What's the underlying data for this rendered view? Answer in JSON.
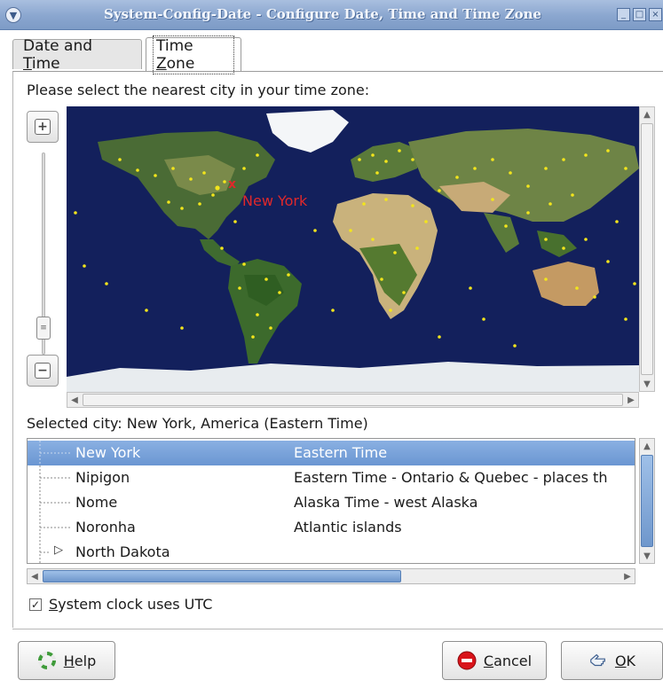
{
  "window": {
    "title": "System-Config-Date - Configure Date, Time and Time Zone",
    "controls": [
      "minimize-icon",
      "maximize-icon",
      "close-icon"
    ]
  },
  "tabs": [
    {
      "label": "Date and Time",
      "mnemonic": "T",
      "active": false
    },
    {
      "label": "Time Zone",
      "mnemonic": "Z",
      "active": true
    }
  ],
  "time_zone": {
    "prompt": "Please select the nearest city in your time zone:",
    "map": {
      "highlight_label": "New York",
      "highlight_marker": "x"
    },
    "zoom": {
      "in_icon": "zoom-in-icon",
      "out_icon": "zoom-out-icon"
    },
    "selected_city": "Selected city: New York, America (Eastern Time)",
    "cities": [
      {
        "name": "New York",
        "zone": "Eastern Time",
        "selected": true,
        "expander": false
      },
      {
        "name": "Nipigon",
        "zone": "Eastern Time - Ontario & Quebec - places th",
        "selected": false,
        "expander": false
      },
      {
        "name": "Nome",
        "zone": "Alaska Time - west Alaska",
        "selected": false,
        "expander": false
      },
      {
        "name": "Noronha",
        "zone": "Atlantic islands",
        "selected": false,
        "expander": false
      },
      {
        "name": "North Dakota",
        "zone": "",
        "selected": false,
        "expander": true
      }
    ],
    "utc_checkbox": {
      "label": "System clock uses UTC",
      "checked": true,
      "mnemonic": "S"
    }
  },
  "buttons": {
    "help": {
      "label": "Help",
      "mnemonic": "H",
      "icon": "help-lifebuoy-icon"
    },
    "cancel": {
      "label": "Cancel",
      "mnemonic": "C",
      "icon": "stop-icon"
    },
    "ok": {
      "label": "OK",
      "mnemonic": "O",
      "icon": "ok-hand-icon"
    }
  },
  "colors": {
    "selection": "#6a96d2",
    "city_marker": "#f2e51c",
    "highlight_marker": "#e0282b",
    "ocean": "#13205c"
  }
}
